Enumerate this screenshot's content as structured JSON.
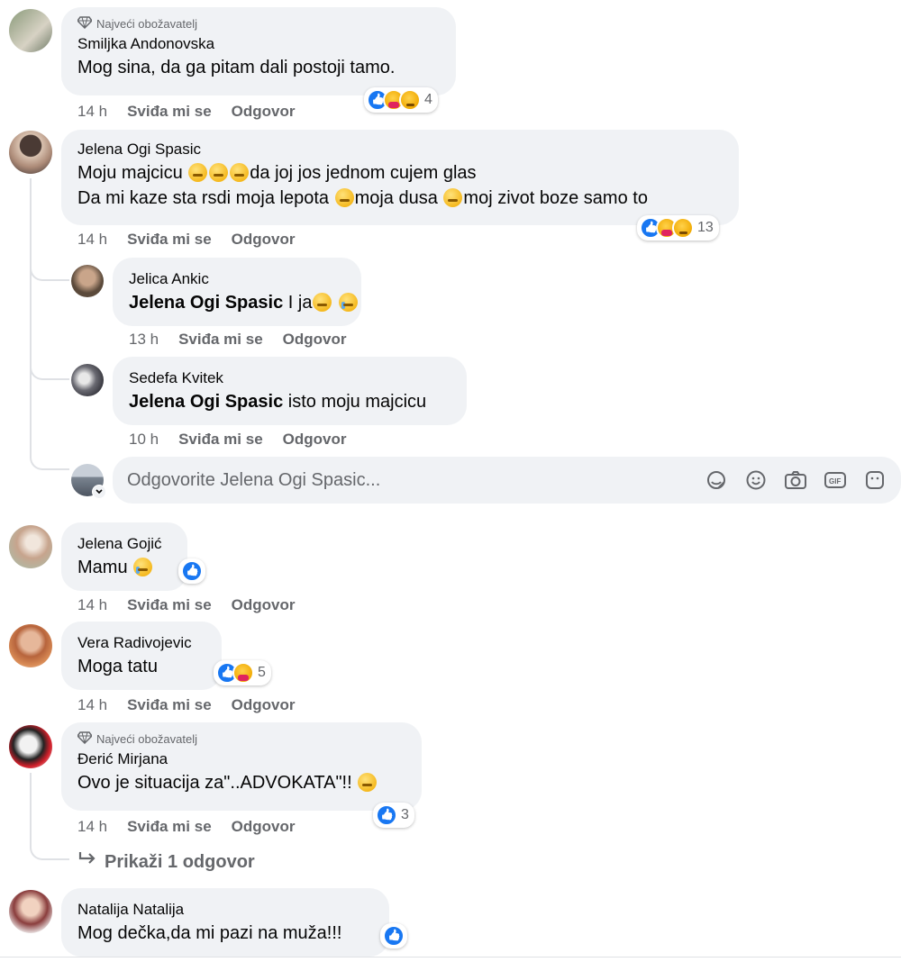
{
  "badge_label": "Najveći obožavatelj",
  "like_label": "Sviđa mi se",
  "reply_label": "Odgovor",
  "comments": [
    {
      "author": "Smiljka Andonovska",
      "text": "Mog sina, da ga pitam dali postoji tamo.",
      "time": "14 h",
      "reaction_count": "4"
    },
    {
      "author": "Jelena Ogi Spasic",
      "text_line1": "Moju majcicu",
      "text_line1b": "da joj jos jednom cujem glas",
      "text_line2a": "Da mi kaze sta rsdi moja lepota",
      "text_line2b": "moja dusa",
      "text_line2c": "moj zivot boze samo to",
      "time": "14 h",
      "reaction_count": "13"
    },
    {
      "author": "Jelena Gojić",
      "text": "Mamu",
      "time": "14 h"
    },
    {
      "author": "Vera Radivojevic",
      "text": "Moga tatu",
      "time": "14 h",
      "reaction_count": "5"
    },
    {
      "author": "Đerić Mirjana",
      "text": "Ovo je situacija za\"..ADVOKATA\"!!",
      "time": "14 h",
      "reaction_count": "3"
    },
    {
      "author": "Natalija Natalija",
      "text": "Mog dečka,da mi pazi na muža!!!"
    }
  ],
  "replies": [
    {
      "author": "Jelica Ankic",
      "mention": "Jelena Ogi Spasic",
      "text": "I ja",
      "time": "13 h"
    },
    {
      "author": "Sedefa Kvitek",
      "mention": "Jelena Ogi Spasic",
      "text": "isto moju majcicu",
      "time": "10 h"
    }
  ],
  "reply_input": {
    "placeholder": "Odgovorite Jelena Ogi Spasic..."
  },
  "view_replies": "Prikaži 1 odgovor",
  "icons": [
    "diamond-icon",
    "sticker-icon",
    "emoji-icon",
    "camera-icon",
    "gif-icon",
    "sticker-icon"
  ],
  "colors": {
    "bubble": "#f0f2f5",
    "like_blue": "#1877f2",
    "secondary_text": "#65676b"
  }
}
